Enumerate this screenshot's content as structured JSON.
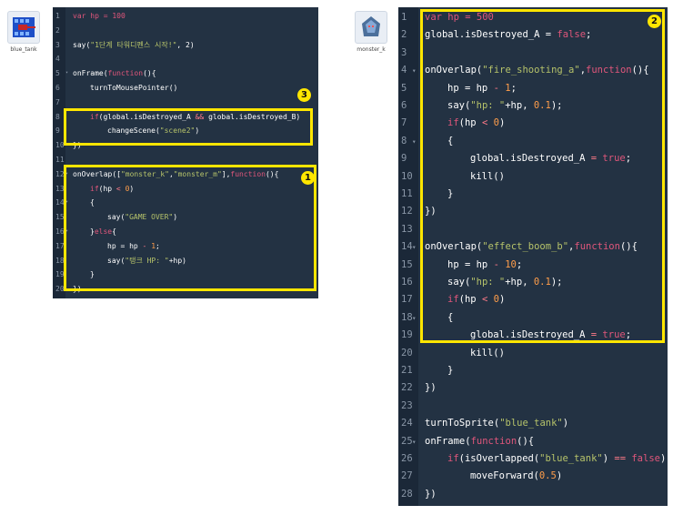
{
  "colors": {
    "editor_bg": "#233243",
    "highlight": "#ffe600",
    "keyword": "#e0567b",
    "function": "#79b8ff",
    "string": "#b6c36a",
    "number": "#ff9d4a",
    "operator": "#ff7a88"
  },
  "left": {
    "sprite": {
      "name": "blue_tank",
      "icon": "blue-tank-icon"
    },
    "badges": {
      "b1": "1",
      "b3": "3"
    },
    "lines": [
      {
        "n": "1",
        "fold": false,
        "indent": 0,
        "tokens": [
          {
            "t": "var hp = 100",
            "c": "kw"
          }
        ]
      },
      {
        "n": "2",
        "fold": false,
        "indent": 0,
        "tokens": []
      },
      {
        "n": "3",
        "fold": false,
        "indent": 0,
        "tokens": [
          {
            "t": "say(",
            "c": "pl"
          },
          {
            "t": "\"1단계 타워디펜스 시작!\"",
            "c": "str"
          },
          {
            "t": ", 2)",
            "c": "pl"
          }
        ]
      },
      {
        "n": "4",
        "fold": false,
        "indent": 0,
        "tokens": []
      },
      {
        "n": "5",
        "fold": true,
        "indent": 0,
        "tokens": [
          {
            "t": "onFrame(",
            "c": "pl"
          },
          {
            "t": "function",
            "c": "kw"
          },
          {
            "t": "(){",
            "c": "pl"
          }
        ]
      },
      {
        "n": "6",
        "fold": false,
        "indent": 1,
        "tokens": [
          {
            "t": "turnToMousePointer()",
            "c": "pl"
          }
        ]
      },
      {
        "n": "7",
        "fold": false,
        "indent": 0,
        "tokens": []
      },
      {
        "n": "8",
        "fold": false,
        "indent": 1,
        "tokens": [
          {
            "t": "if",
            "c": "kw"
          },
          {
            "t": "(global.isDestroyed_A ",
            "c": "pl"
          },
          {
            "t": "&&",
            "c": "op"
          },
          {
            "t": " global.isDestroyed_B)",
            "c": "pl"
          }
        ]
      },
      {
        "n": "9",
        "fold": false,
        "indent": 2,
        "tokens": [
          {
            "t": "changeScene(",
            "c": "pl"
          },
          {
            "t": "\"scene2\"",
            "c": "str"
          },
          {
            "t": ")",
            "c": "pl"
          }
        ]
      },
      {
        "n": "10",
        "fold": false,
        "indent": 0,
        "tokens": [
          {
            "t": "})",
            "c": "pl"
          }
        ]
      },
      {
        "n": "11",
        "fold": false,
        "indent": 0,
        "tokens": []
      },
      {
        "n": "12",
        "fold": true,
        "indent": 0,
        "tokens": [
          {
            "t": "onOverlap([",
            "c": "pl"
          },
          {
            "t": "\"monster_k\"",
            "c": "str"
          },
          {
            "t": ",",
            "c": "pl"
          },
          {
            "t": "\"monster_m\"",
            "c": "str"
          },
          {
            "t": "],",
            "c": "pl"
          },
          {
            "t": "function",
            "c": "kw"
          },
          {
            "t": "(){",
            "c": "pl"
          }
        ]
      },
      {
        "n": "13",
        "fold": false,
        "indent": 1,
        "tokens": [
          {
            "t": "if",
            "c": "kw"
          },
          {
            "t": "(hp ",
            "c": "pl"
          },
          {
            "t": "<",
            "c": "op"
          },
          {
            "t": " ",
            "c": "pl"
          },
          {
            "t": "0",
            "c": "num"
          },
          {
            "t": ")",
            "c": "pl"
          }
        ]
      },
      {
        "n": "14",
        "fold": true,
        "indent": 1,
        "tokens": [
          {
            "t": "{",
            "c": "pl"
          }
        ]
      },
      {
        "n": "15",
        "fold": false,
        "indent": 2,
        "tokens": [
          {
            "t": "say(",
            "c": "pl"
          },
          {
            "t": "\"GAME OVER\"",
            "c": "str"
          },
          {
            "t": ")",
            "c": "pl"
          }
        ]
      },
      {
        "n": "16",
        "fold": true,
        "indent": 1,
        "tokens": [
          {
            "t": "}",
            "c": "pl"
          },
          {
            "t": "else",
            "c": "kw"
          },
          {
            "t": "{",
            "c": "pl"
          }
        ]
      },
      {
        "n": "17",
        "fold": false,
        "indent": 2,
        "tokens": [
          {
            "t": "hp = hp ",
            "c": "pl"
          },
          {
            "t": "-",
            "c": "op"
          },
          {
            "t": " ",
            "c": "pl"
          },
          {
            "t": "1",
            "c": "num"
          },
          {
            "t": ";",
            "c": "pl"
          }
        ]
      },
      {
        "n": "18",
        "fold": false,
        "indent": 2,
        "tokens": [
          {
            "t": "say(",
            "c": "pl"
          },
          {
            "t": "\"탱크 HP: \"",
            "c": "str"
          },
          {
            "t": "+hp)",
            "c": "pl"
          }
        ]
      },
      {
        "n": "19",
        "fold": false,
        "indent": 1,
        "tokens": [
          {
            "t": "}",
            "c": "pl"
          }
        ]
      },
      {
        "n": "20",
        "fold": false,
        "indent": 0,
        "tokens": [
          {
            "t": "})",
            "c": "pl"
          }
        ]
      }
    ]
  },
  "right": {
    "sprite": {
      "name": "monster_k",
      "icon": "monster-k-icon"
    },
    "badges": {
      "b2": "2"
    },
    "lines": [
      {
        "n": "1",
        "fold": false,
        "indent": 0,
        "tokens": [
          {
            "t": "var hp = 500",
            "c": "kw"
          }
        ]
      },
      {
        "n": "2",
        "fold": false,
        "indent": 0,
        "tokens": [
          {
            "t": "global.isDestroyed_A = ",
            "c": "pl"
          },
          {
            "t": "false",
            "c": "kw"
          },
          {
            "t": ";",
            "c": "pl"
          }
        ]
      },
      {
        "n": "3",
        "fold": false,
        "indent": 0,
        "tokens": []
      },
      {
        "n": "4",
        "fold": true,
        "indent": 0,
        "tokens": [
          {
            "t": "onOverlap(",
            "c": "pl"
          },
          {
            "t": "\"fire_shooting_a\"",
            "c": "str"
          },
          {
            "t": ",",
            "c": "pl"
          },
          {
            "t": "function",
            "c": "kw"
          },
          {
            "t": "(){",
            "c": "pl"
          }
        ]
      },
      {
        "n": "5",
        "fold": false,
        "indent": 1,
        "tokens": [
          {
            "t": "hp = hp ",
            "c": "pl"
          },
          {
            "t": "-",
            "c": "op"
          },
          {
            "t": " ",
            "c": "pl"
          },
          {
            "t": "1",
            "c": "num"
          },
          {
            "t": ";",
            "c": "pl"
          }
        ]
      },
      {
        "n": "6",
        "fold": false,
        "indent": 1,
        "tokens": [
          {
            "t": "say(",
            "c": "pl"
          },
          {
            "t": "\"hp: \"",
            "c": "str"
          },
          {
            "t": "+hp, ",
            "c": "pl"
          },
          {
            "t": "0.1",
            "c": "num"
          },
          {
            "t": ");",
            "c": "pl"
          }
        ]
      },
      {
        "n": "7",
        "fold": false,
        "indent": 1,
        "tokens": [
          {
            "t": "if",
            "c": "kw"
          },
          {
            "t": "(hp ",
            "c": "pl"
          },
          {
            "t": "<",
            "c": "op"
          },
          {
            "t": " ",
            "c": "pl"
          },
          {
            "t": "0",
            "c": "num"
          },
          {
            "t": ")",
            "c": "pl"
          }
        ]
      },
      {
        "n": "8",
        "fold": true,
        "indent": 1,
        "tokens": [
          {
            "t": "{",
            "c": "pl"
          }
        ]
      },
      {
        "n": "9",
        "fold": false,
        "indent": 2,
        "tokens": [
          {
            "t": "global.isDestroyed_A ",
            "c": "pl"
          },
          {
            "t": "=",
            "c": "op"
          },
          {
            "t": " ",
            "c": "pl"
          },
          {
            "t": "true",
            "c": "kw"
          },
          {
            "t": ";",
            "c": "pl"
          }
        ]
      },
      {
        "n": "10",
        "fold": false,
        "indent": 2,
        "tokens": [
          {
            "t": "kill()",
            "c": "pl"
          }
        ]
      },
      {
        "n": "11",
        "fold": false,
        "indent": 1,
        "tokens": [
          {
            "t": "}",
            "c": "pl"
          }
        ]
      },
      {
        "n": "12",
        "fold": false,
        "indent": 0,
        "tokens": [
          {
            "t": "})",
            "c": "pl"
          }
        ]
      },
      {
        "n": "13",
        "fold": false,
        "indent": 0,
        "tokens": []
      },
      {
        "n": "14",
        "fold": true,
        "indent": 0,
        "tokens": [
          {
            "t": "onOverlap(",
            "c": "pl"
          },
          {
            "t": "\"effect_boom_b\"",
            "c": "str"
          },
          {
            "t": ",",
            "c": "pl"
          },
          {
            "t": "function",
            "c": "kw"
          },
          {
            "t": "(){",
            "c": "pl"
          }
        ]
      },
      {
        "n": "15",
        "fold": false,
        "indent": 1,
        "tokens": [
          {
            "t": "hp = hp ",
            "c": "pl"
          },
          {
            "t": "-",
            "c": "op"
          },
          {
            "t": " ",
            "c": "pl"
          },
          {
            "t": "10",
            "c": "num"
          },
          {
            "t": ";",
            "c": "pl"
          }
        ]
      },
      {
        "n": "16",
        "fold": false,
        "indent": 1,
        "tokens": [
          {
            "t": "say(",
            "c": "pl"
          },
          {
            "t": "\"hp: \"",
            "c": "str"
          },
          {
            "t": "+hp, ",
            "c": "pl"
          },
          {
            "t": "0.1",
            "c": "num"
          },
          {
            "t": ");",
            "c": "pl"
          }
        ]
      },
      {
        "n": "17",
        "fold": false,
        "indent": 1,
        "tokens": [
          {
            "t": "if",
            "c": "kw"
          },
          {
            "t": "(hp ",
            "c": "pl"
          },
          {
            "t": "<",
            "c": "op"
          },
          {
            "t": " ",
            "c": "pl"
          },
          {
            "t": "0",
            "c": "num"
          },
          {
            "t": ")",
            "c": "pl"
          }
        ]
      },
      {
        "n": "18",
        "fold": true,
        "indent": 1,
        "tokens": [
          {
            "t": "{",
            "c": "pl"
          }
        ]
      },
      {
        "n": "19",
        "fold": false,
        "indent": 2,
        "tokens": [
          {
            "t": "global.isDestroyed_A ",
            "c": "pl"
          },
          {
            "t": "=",
            "c": "op"
          },
          {
            "t": " ",
            "c": "pl"
          },
          {
            "t": "true",
            "c": "kw"
          },
          {
            "t": ";",
            "c": "pl"
          }
        ]
      },
      {
        "n": "20",
        "fold": false,
        "indent": 2,
        "tokens": [
          {
            "t": "kill()",
            "c": "pl"
          }
        ]
      },
      {
        "n": "21",
        "fold": false,
        "indent": 1,
        "tokens": [
          {
            "t": "}",
            "c": "pl"
          }
        ]
      },
      {
        "n": "22",
        "fold": false,
        "indent": 0,
        "tokens": [
          {
            "t": "})",
            "c": "pl"
          }
        ]
      },
      {
        "n": "23",
        "fold": false,
        "indent": 0,
        "tokens": []
      },
      {
        "n": "24",
        "fold": false,
        "indent": 0,
        "tokens": [
          {
            "t": "turnToSprite(",
            "c": "pl"
          },
          {
            "t": "\"blue_tank\"",
            "c": "str"
          },
          {
            "t": ")",
            "c": "pl"
          }
        ]
      },
      {
        "n": "25",
        "fold": true,
        "indent": 0,
        "tokens": [
          {
            "t": "onFrame(",
            "c": "pl"
          },
          {
            "t": "function",
            "c": "kw"
          },
          {
            "t": "(){",
            "c": "pl"
          }
        ]
      },
      {
        "n": "26",
        "fold": false,
        "indent": 1,
        "tokens": [
          {
            "t": "if",
            "c": "kw"
          },
          {
            "t": "(isOverlapped(",
            "c": "pl"
          },
          {
            "t": "\"blue_tank\"",
            "c": "str"
          },
          {
            "t": ") ",
            "c": "pl"
          },
          {
            "t": "==",
            "c": "op"
          },
          {
            "t": " ",
            "c": "pl"
          },
          {
            "t": "false",
            "c": "kw"
          },
          {
            "t": ")",
            "c": "pl"
          }
        ]
      },
      {
        "n": "27",
        "fold": false,
        "indent": 2,
        "tokens": [
          {
            "t": "moveForward(",
            "c": "pl"
          },
          {
            "t": "0.5",
            "c": "num"
          },
          {
            "t": ")",
            "c": "pl"
          }
        ]
      },
      {
        "n": "28",
        "fold": false,
        "indent": 0,
        "tokens": [
          {
            "t": "})",
            "c": "pl"
          }
        ]
      }
    ]
  }
}
